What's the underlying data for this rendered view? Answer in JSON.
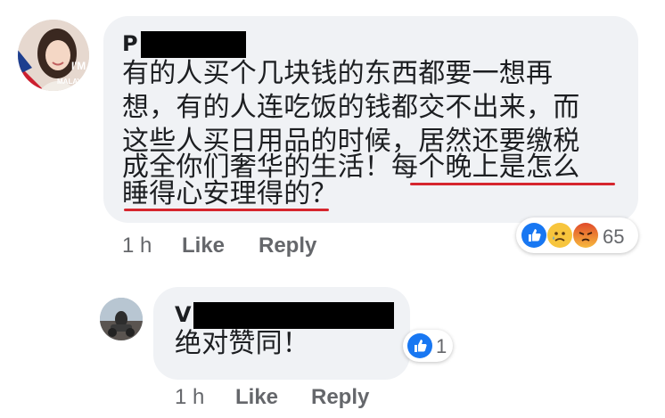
{
  "comments": [
    {
      "author_initial": "P",
      "lines": [
        "有的人买个几块钱的东西都要一想再",
        "想，有的人连吃饭的钱都交不出来，而",
        "这些人买日用品的时候，居然还要缴税",
        "成全你们奢华的生活！每个晚上是怎么",
        "睡得心安理得的？"
      ],
      "time": "1 h",
      "like_label": "Like",
      "reply_label": "Reply",
      "reaction_count": "65",
      "reactions": [
        "like-icon",
        "sad-icon",
        "angry-icon"
      ],
      "avatar_text": "I'M MALAYSIA"
    },
    {
      "author_initial": "V",
      "lines": [
        "绝对赞同！"
      ],
      "time": "1 h",
      "like_label": "Like",
      "reply_label": "Reply",
      "reaction_count": "1",
      "reactions": [
        "like-icon"
      ]
    }
  ],
  "colors": {
    "bubble": "#f0f2f5",
    "like_blue": "#1877f2",
    "underline_red": "#d6262e",
    "meta_gray": "#65676b"
  }
}
